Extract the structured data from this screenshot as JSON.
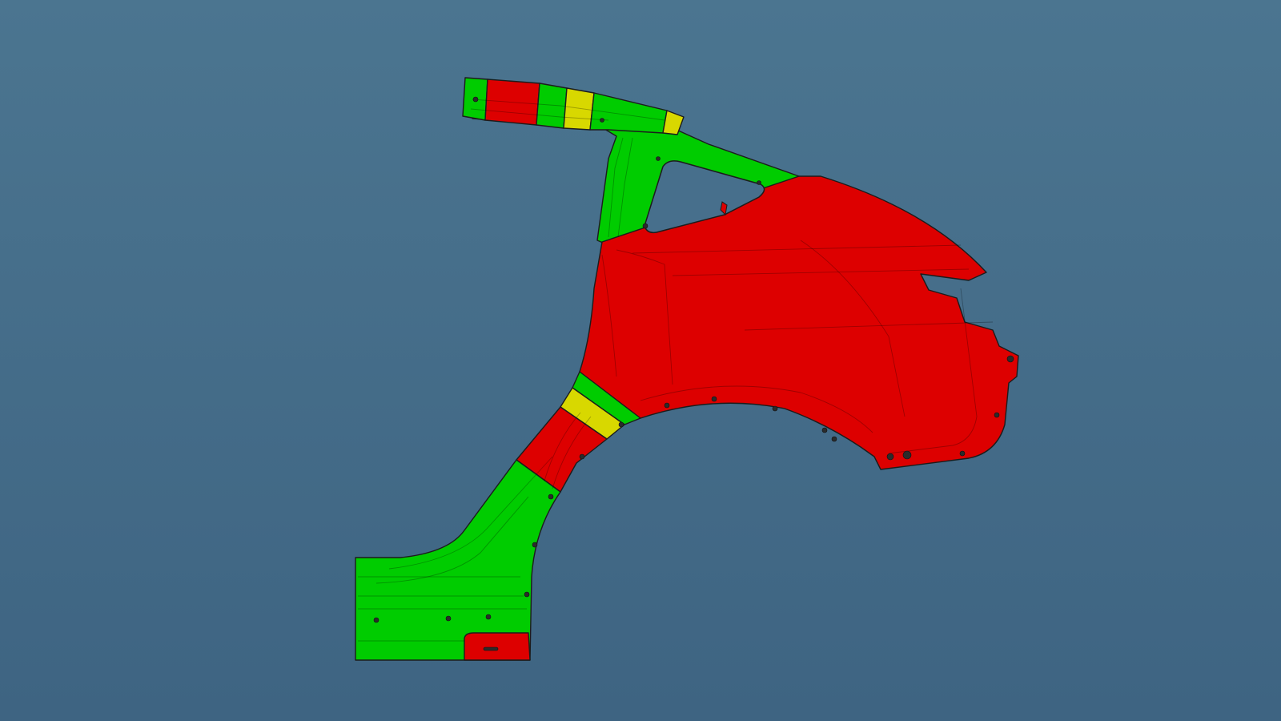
{
  "viewport": {
    "background_top": "#4b7590",
    "background_bottom": "#3e6482"
  },
  "zone_colors": {
    "green": "#00cc00",
    "red": "#dd0000",
    "yellow": "#d8d800"
  },
  "part": {
    "name": "rear-quarter-panel",
    "zones": [
      {
        "id": "roof-rail-a",
        "color": "green"
      },
      {
        "id": "roof-rail-b",
        "color": "red"
      },
      {
        "id": "roof-rail-c",
        "color": "green"
      },
      {
        "id": "roof-rail-d",
        "color": "yellow"
      },
      {
        "id": "roof-rail-e",
        "color": "green"
      },
      {
        "id": "roof-rail-tip",
        "color": "yellow"
      },
      {
        "id": "c-pillar",
        "color": "green"
      },
      {
        "id": "quarter-main",
        "color": "red"
      },
      {
        "id": "wheel-arch-band-green",
        "color": "green"
      },
      {
        "id": "wheel-arch-band-yellow",
        "color": "yellow"
      },
      {
        "id": "wheel-arch-band-red",
        "color": "red"
      },
      {
        "id": "rocker-section",
        "color": "green"
      },
      {
        "id": "rocker-pocket",
        "color": "red"
      }
    ]
  }
}
